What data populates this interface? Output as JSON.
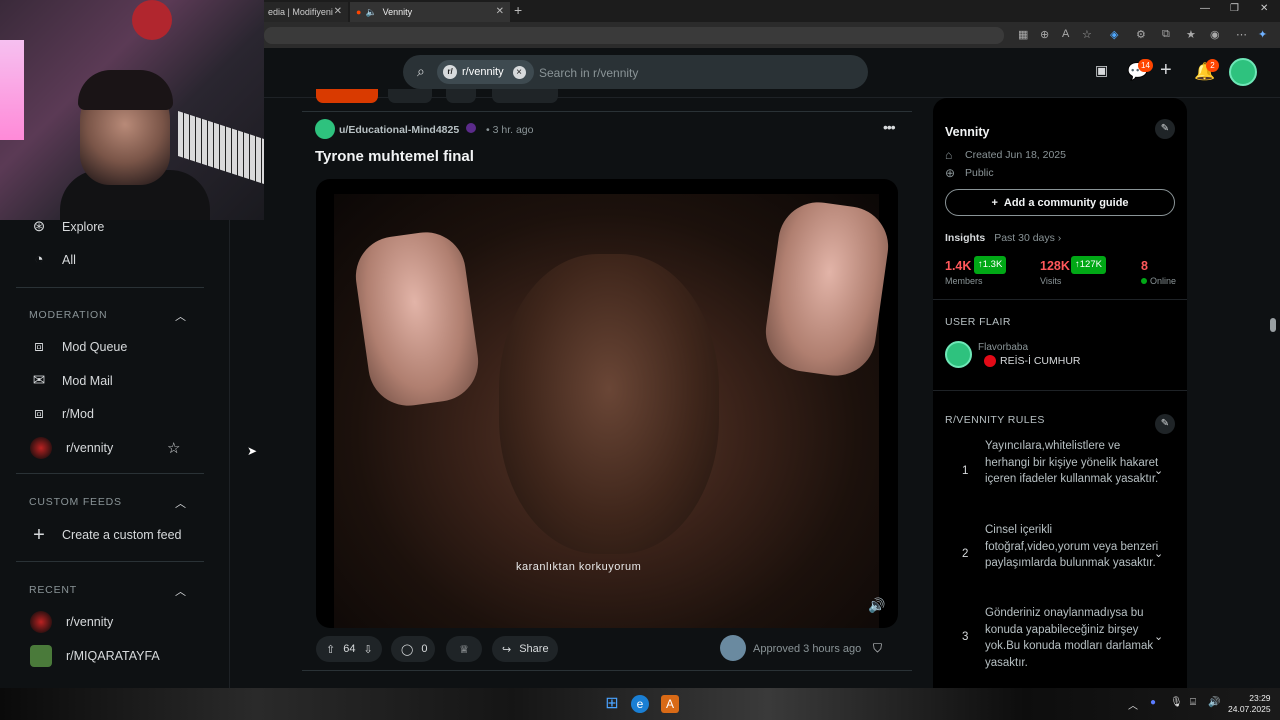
{
  "browser": {
    "tabs": [
      {
        "label": "edia | Modifiyeni"
      },
      {
        "label": "Vennity"
      }
    ]
  },
  "header": {
    "search_chip": "r/vennity",
    "search_placeholder": "Search in r/vennity",
    "chat_badge": "14",
    "notif_badge": "2"
  },
  "sidebar": {
    "top_items": [
      {
        "label": "Explore",
        "icon": "explore-icon"
      },
      {
        "label": "All",
        "icon": "all-icon"
      }
    ],
    "moderation": {
      "header": "MODERATION",
      "items": [
        {
          "label": "Mod Queue",
          "icon": "mod-queue-icon"
        },
        {
          "label": "Mod Mail",
          "icon": "mod-mail-icon"
        },
        {
          "label": "r/Mod",
          "icon": "r-mod-icon"
        },
        {
          "label": "r/vennity",
          "icon": "vennity-avatar"
        }
      ]
    },
    "custom_feeds": {
      "header": "CUSTOM FEEDS",
      "create_label": "Create a custom feed"
    },
    "recent": {
      "header": "RECENT",
      "items": [
        {
          "label": "r/vennity"
        },
        {
          "label": "r/MIQARATAYFA"
        }
      ]
    }
  },
  "post": {
    "user": "u/Educational-Mind4825",
    "time": "• 3 hr. ago",
    "title": "Tyrone muhtemel final",
    "caption": "karanlıktan korkuyorum",
    "votes": "64",
    "comments": "0",
    "share_label": "Share",
    "approved": "Approved 3 hours ago"
  },
  "community": {
    "name": "Vennity",
    "created": "Created Jun 18, 2025",
    "visibility": "Public",
    "guide_button": "Add a community guide",
    "insights_label": "Insights",
    "insights_range": "Past 30 days ›",
    "members_value": "1.4K",
    "members_growth": "↑1.3K",
    "members_label": "Members",
    "visits_value": "128K",
    "visits_growth": "↑127K",
    "visits_label": "Visits",
    "online_value": "8",
    "online_label": "Online",
    "flair_header": "USER FLAIR",
    "flair_user": "Flavorbaba",
    "flair_tag": "REİS-İ CUMHUR",
    "rules_header": "R/VENNITY RULES",
    "rules": [
      {
        "n": "1",
        "text": "Yayıncılara,whitelistlere ve herhangi bir kişiye yönelik hakaret içeren ifadeler kullanmak yasaktır."
      },
      {
        "n": "2",
        "text": "Cinsel içerikli fotoğraf,video,yorum veya benzeri paylaşımlarda bulunmak yasaktır."
      },
      {
        "n": "3",
        "text": "Gönderiniz onaylanmadıysa bu konuda yapabileceğiniz birşey yok.Bu konuda modları darlamak yasaktır."
      }
    ]
  },
  "taskbar": {
    "time": "23:29",
    "date": "24.07.2025"
  },
  "colors": {
    "background": "#0e1113",
    "accent": "#ff4500",
    "growth": "#01a816",
    "stat": "#ff585b"
  }
}
